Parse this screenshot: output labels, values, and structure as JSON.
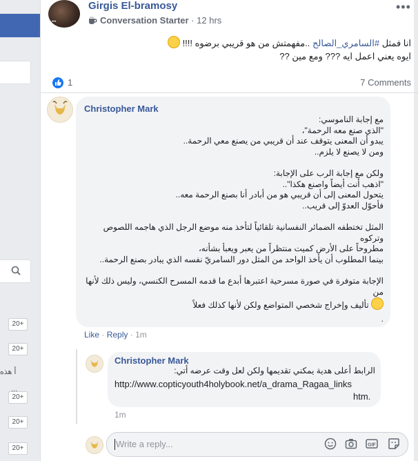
{
  "sidebar": {
    "badges": [
      "20+",
      "20+",
      "20+",
      "20+",
      "20+"
    ],
    "fragment_text": "أ هذه",
    "fragment_dots": "..."
  },
  "post": {
    "author": "Girgis El-bramosy",
    "badge": "Conversation Starter",
    "time": "12 hrs",
    "line1_prefix": "انا فمثل ",
    "hashtag": "#السامري_الصالح",
    "line1_suffix": " ..مفهمتش من هو قريبي برضوه !!!! ",
    "line2": "ايوه يعني اعمل ايه ??? ومع مين ??",
    "likes": "1",
    "comments": "7 Comments"
  },
  "comment1": {
    "author": "Christopher Mark",
    "lines": [
      "مع إجابة الناموسي:",
      "\"الذي صنع معه الرحمة\"،",
      "يبدو أن المعنى يتوقف عند أن قريبي من يصنع معي الرحمة..",
      "ومن لا يصنع لا يلزم..",
      "",
      "ولكن مع إجابة الرب على الإجابة:",
      "\"اذهب أنت أيضاً واصنع هكذا\"..",
      "يتحول المعنى إلى أن قريبي هو من أبادر أنا بصنع الرحمة معه..",
      "فأحوّل العدوّ إلى قريب..",
      "",
      "المثل تختطفه الضمائر النفسانية تلقائياً لتأخذ منه موضع الرجل الذي هاجمه اللصوص وتركوه",
      "مطروحاً على الأرض كميت منتظراً من يعبر ويعبأ بشأنه،",
      "بينما المطلوب أن يأخذ الواحد من المثل دور السامريّ نفسه الذي يبادر بصنع الرحمة..",
      "",
      "الإجابة متوفرة في صورة مسرحية اعتبرها أبدع ما قدمه المسرح الكنسي، وليس ذلك لأنها من",
      "تأليف وإخراج شخصي المتواضع ولكن لأنها كذلك فعلاً",
      "."
    ],
    "like": "Like",
    "reply": "Reply",
    "time": "1m"
  },
  "comment2": {
    "author": "Christopher Mark",
    "text": "الرابط أعلى هدية يمكني تقديمها ولكن لعل وقت عرضه أتي:",
    "link_line1": "http://www.copticyouth4holybook.net/a_drama_Ragaa_links",
    "link_line2": "htm.",
    "time": "1m"
  },
  "reply_box": {
    "placeholder": "Write a reply..."
  },
  "colors": {
    "link": "#385898",
    "bubble": "#f2f3f5",
    "like_blue": "#1877f2",
    "sidebar_blue": "#4267b2"
  }
}
